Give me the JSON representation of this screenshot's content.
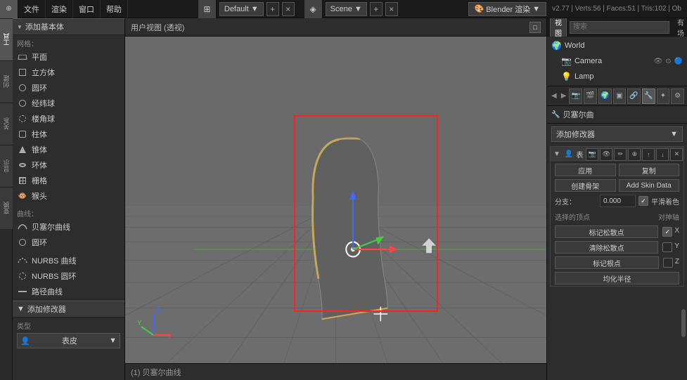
{
  "topbar": {
    "icon": "⊕",
    "menus": [
      "文件",
      "渲染",
      "窗口",
      "帮助"
    ],
    "editor1_label": "Default",
    "editor2_label": "Scene",
    "engine_label": "Blender 渲染",
    "version_label": "v2.77 | Verts:56 | Faces:51 | Tris:102 | Ob"
  },
  "left_sidebar": {
    "add_primitive_header": "添加基本体",
    "mesh_label": "网格：",
    "mesh_items": [
      {
        "label": "平面",
        "icon": "plane"
      },
      {
        "label": "立方体",
        "icon": "cube"
      },
      {
        "label": "圆环",
        "icon": "circle"
      },
      {
        "label": "经纬球",
        "icon": "sphere"
      },
      {
        "label": "楼角球",
        "icon": "sphere2"
      },
      {
        "label": "柱体",
        "icon": "cylinder"
      },
      {
        "label": "锥体",
        "icon": "cone"
      },
      {
        "label": "环体",
        "icon": "torus"
      },
      {
        "label": "栅格",
        "icon": "grid"
      },
      {
        "label": "猴头",
        "icon": "monkey"
      }
    ],
    "curves_label": "曲线：",
    "curves_items": [
      {
        "label": "贝塞尔曲线",
        "icon": "bezier"
      },
      {
        "label": "圆环",
        "icon": "circle"
      }
    ],
    "nurbs_items": [
      {
        "label": "NURBS 曲线",
        "icon": "nurbs"
      },
      {
        "label": "NURBS 圆环",
        "icon": "nurbs"
      },
      {
        "label": "路径曲线",
        "icon": "path"
      }
    ],
    "add_modifier_header": "添加修改器",
    "type_label": "类型",
    "type_value": "表皮"
  },
  "viewport": {
    "title": "用户视图 (透视)",
    "bottom_text": "(1) 贝塞尔曲线"
  },
  "right_panel": {
    "tabs": [
      "视图",
      "搜索",
      "所有场景"
    ],
    "outliner_items": [
      {
        "label": "World",
        "icon": "🌍",
        "indent": false
      },
      {
        "label": "Camera",
        "icon": "📷",
        "indent": true
      },
      {
        "label": "Lamp",
        "icon": "💡",
        "indent": true
      }
    ],
    "prop_icons": [
      "⚙",
      "▼",
      "👁",
      "📦",
      "🔺",
      "〰",
      "🔵",
      "⬜",
      "▦",
      "💠",
      "✦",
      "🔲"
    ],
    "modifier_name": "贝塞尔曲",
    "add_modifier_btn": "添加修改器",
    "apply_btn": "应用",
    "copy_btn": "复制",
    "create_skeleton_btn": "创建骨架",
    "add_skin_data_btn": "Add Skin Data",
    "branch_label": "分支：",
    "branch_value": "0.000",
    "smooth_label": "平滑着色",
    "select_vertex_label": "选择的顶点",
    "mirror_axis_label": "对抻轴",
    "mark_loose_btn": "标记松散点",
    "x_toggle": "X",
    "clear_loose_btn": "清除松散点",
    "y_toggle": "Y",
    "mark_root_btn": "标记根点",
    "z_toggle": "Z",
    "equalize_btn": "均化半径"
  }
}
